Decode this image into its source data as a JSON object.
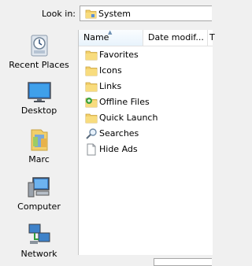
{
  "lookin": {
    "label": "Look in:",
    "value": "System"
  },
  "places": [
    {
      "label": "Recent Places",
      "icon": "recent-places-icon"
    },
    {
      "label": "Desktop",
      "icon": "desktop-icon"
    },
    {
      "label": "Marc",
      "icon": "user-folder-icon"
    },
    {
      "label": "Computer",
      "icon": "computer-icon"
    },
    {
      "label": "Network",
      "icon": "network-icon"
    }
  ],
  "columns": {
    "name": "Name",
    "date": "Date modif...",
    "type": "T"
  },
  "files": [
    {
      "name": "Favorites",
      "icon": "folder-icon"
    },
    {
      "name": "Icons",
      "icon": "folder-icon"
    },
    {
      "name": "Links",
      "icon": "folder-icon"
    },
    {
      "name": "Offline Files",
      "icon": "offline-files-icon"
    },
    {
      "name": "Quick Launch",
      "icon": "folder-icon"
    },
    {
      "name": "Searches",
      "icon": "searches-icon"
    },
    {
      "name": "Hide Ads",
      "icon": "file-icon"
    }
  ]
}
